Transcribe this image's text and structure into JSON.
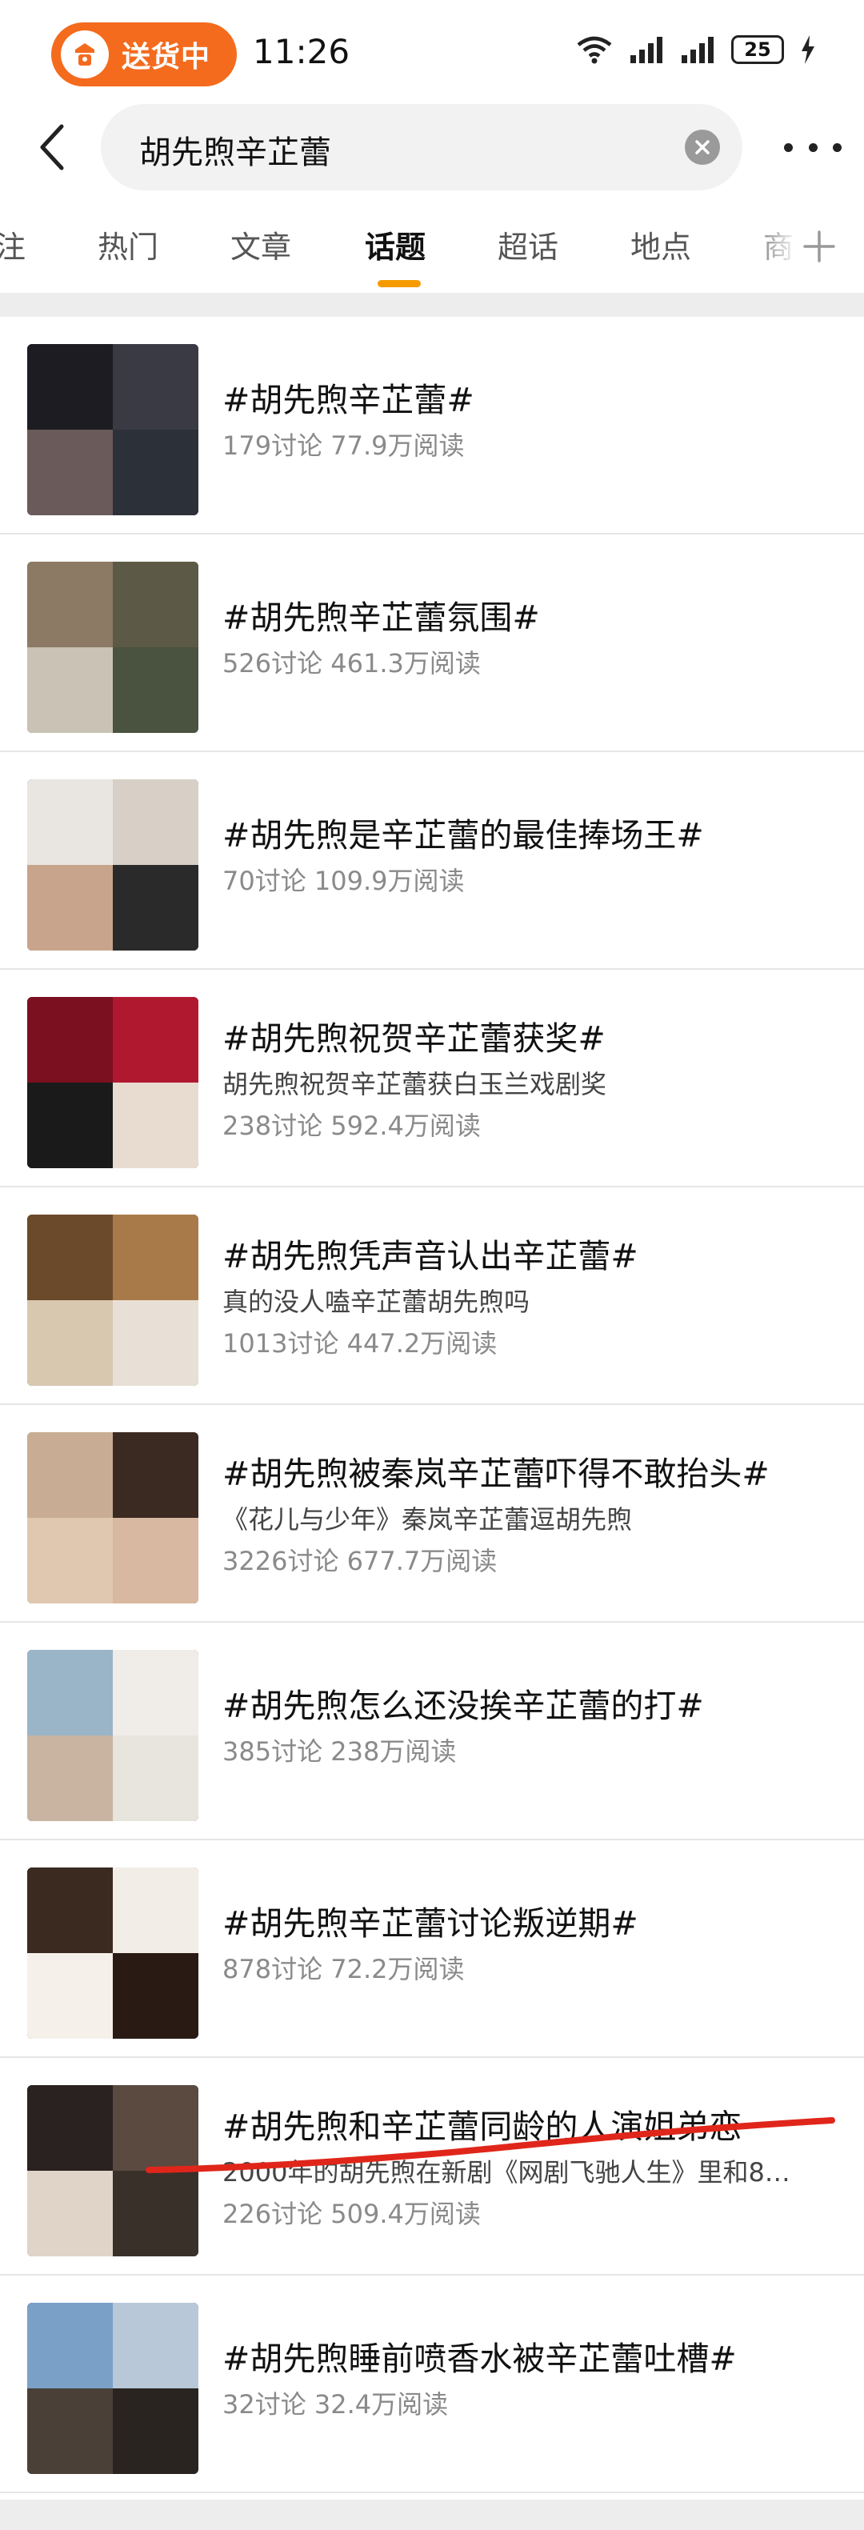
{
  "status_bar": {
    "delivery_label": "送货中",
    "time": "11:26",
    "battery": "25",
    "icons": [
      "delivery-logo-icon",
      "wifi-icon",
      "signal-icon",
      "signal-icon",
      "battery-icon",
      "charging-icon"
    ]
  },
  "search": {
    "query": "胡先煦辛芷蕾",
    "back_icon": "back-arrow-icon",
    "clear_icon": "clear-icon",
    "more_icon": "more-dots-icon"
  },
  "tabs": {
    "items": [
      "注",
      "热门",
      "文章",
      "话题",
      "超话",
      "地点",
      "商"
    ],
    "active": "话题",
    "accent": "#f59b00"
  },
  "topics": [
    {
      "title": "#胡先煦辛芷蕾#",
      "desc": "",
      "stats": "179讨论 77.9万阅读",
      "thumb_colors": [
        "#1c1c22",
        "#3a3a44",
        "#6a5a5a",
        "#2c3038"
      ]
    },
    {
      "title": "#胡先煦辛芷蕾氛围#",
      "desc": "",
      "stats": "526讨论 461.3万阅读",
      "thumb_colors": [
        "#8c7a64",
        "#5c5a46",
        "#c9c2b5",
        "#4a5240"
      ]
    },
    {
      "title": "#胡先煦是辛芷蕾的最佳捧场王#",
      "desc": "",
      "stats": "70讨论 109.9万阅读",
      "thumb_colors": [
        "#e9e6e2",
        "#d8cfc6",
        "#c8a48c",
        "#2a2a2a"
      ]
    },
    {
      "title": "#胡先煦祝贺辛芷蕾获奖#",
      "desc": "胡先煦祝贺辛芷蕾获白玉兰戏剧奖",
      "stats": "238讨论 592.4万阅读",
      "thumb_colors": [
        "#7a1020",
        "#b01830",
        "#1a1a1a",
        "#e8dcd0"
      ]
    },
    {
      "title": "#胡先煦凭声音认出辛芷蕾#",
      "desc": "真的没人嗑辛芷蕾胡先煦吗",
      "stats": "1013讨论 447.2万阅读",
      "thumb_colors": [
        "#6a4a2a",
        "#a87a4a",
        "#d8c8b0",
        "#e8e0d6"
      ]
    },
    {
      "title": "#胡先煦被秦岚辛芷蕾吓得不敢抬头#",
      "desc": "《花儿与少年》秦岚辛芷蕾逗胡先煦",
      "stats": "3226讨论 677.7万阅读",
      "thumb_colors": [
        "#c8ad94",
        "#3a2a22",
        "#e0c8b0",
        "#d8b8a0"
      ]
    },
    {
      "title": "#胡先煦怎么还没挨辛芷蕾的打#",
      "desc": "",
      "stats": "385讨论 238万阅读",
      "thumb_colors": [
        "#9ab4c8",
        "#f0ece8",
        "#c8b4a0",
        "#e8e4de"
      ]
    },
    {
      "title": "#胡先煦辛芷蕾讨论叛逆期#",
      "desc": "",
      "stats": "878讨论 72.2万阅读",
      "thumb_colors": [
        "#3a2a20",
        "#f2ede6",
        "#f5f0ea",
        "#2a1a14"
      ]
    },
    {
      "title": "#胡先煦和辛芷蕾同龄的人演姐弟恋",
      "desc": "2000年的胡先煦在新剧《网剧飞驰人生》里和8…",
      "stats": "226讨论 509.4万阅读",
      "thumb_colors": [
        "#2a2220",
        "#5a4a40",
        "#e0d4c8",
        "#3a302a"
      ]
    },
    {
      "title": "#胡先煦睡前喷香水被辛芷蕾吐槽#",
      "desc": "",
      "stats": "32讨论 32.4万阅读",
      "thumb_colors": [
        "#7aa0c8",
        "#b8c8d8",
        "#4a4038",
        "#2a2420"
      ]
    }
  ],
  "annotation": {
    "color": "#e0261a"
  }
}
